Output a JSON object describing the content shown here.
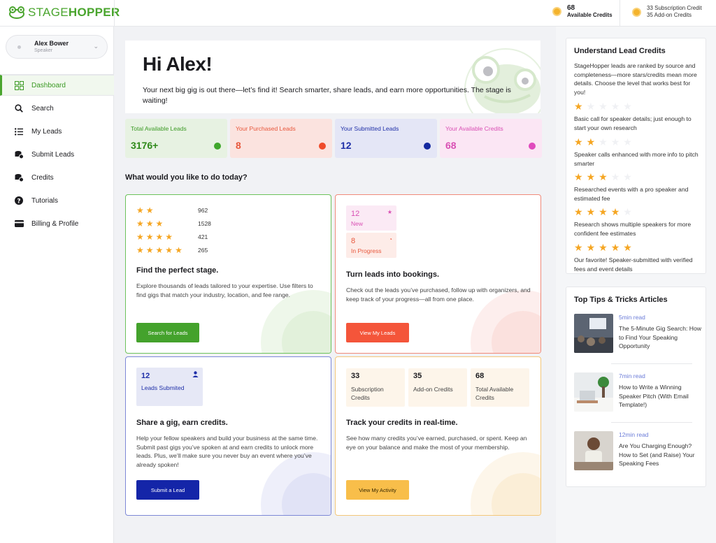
{
  "brand": {
    "part1": "STAGE",
    "part2": "HOPPER"
  },
  "topbar": {
    "available_credits_value": "68",
    "available_credits_label": "Available Credits",
    "subscription_line": "33 Subscription Credit",
    "addon_line": "35 Add-on Credits"
  },
  "user": {
    "name": "Alex Bower",
    "role": "Speaker"
  },
  "nav": [
    {
      "label": "Dashboard",
      "icon": "grid-icon"
    },
    {
      "label": "Search",
      "icon": "search-icon"
    },
    {
      "label": "My Leads",
      "icon": "list-icon"
    },
    {
      "label": "Submit Leads",
      "icon": "coin-stack-icon"
    },
    {
      "label": "Credits",
      "icon": "coin-stack-icon"
    },
    {
      "label": "Tutorials",
      "icon": "question-icon"
    },
    {
      "label": "Billing & Profile",
      "icon": "card-icon"
    }
  ],
  "hero": {
    "greeting": "Hi Alex!",
    "message": "Your next big gig is out there—let’s find it! Search smarter, share leads, and earn more opportunities. The stage is waiting!"
  },
  "stats": [
    {
      "label": "Total Available Leads",
      "value": "3176+",
      "bg": "#e7f2e2",
      "label_color": "#3b9a24",
      "value_color": "#2f8a1a",
      "dot": "#3fa72c"
    },
    {
      "label": "Your Purchased Leads",
      "value": "8",
      "bg": "#fbe3df",
      "label_color": "#e8573c",
      "value_color": "#e8573c",
      "dot": "#ef4b2a"
    },
    {
      "label": "Your Submitted Leads",
      "value": "12",
      "bg": "#e4e6f6",
      "label_color": "#1f2fa8",
      "value_color": "#1f2fa8",
      "dot": "#1429a0"
    },
    {
      "label": "Your Available Credits",
      "value": "68",
      "bg": "#fbe6f4",
      "label_color": "#d94fb4",
      "value_color": "#d94fb4",
      "dot": "#e04bbd"
    }
  ],
  "section_title": "What would you like to do today?",
  "card_find": {
    "ratings": [
      {
        "stars": 2,
        "count": "962"
      },
      {
        "stars": 3,
        "count": "1528"
      },
      {
        "stars": 4,
        "count": "421"
      },
      {
        "stars": 5,
        "count": "265"
      }
    ],
    "title": "Find the perfect stage.",
    "desc": "Explore thousands of leads tailored to your expertise. Use filters to find gigs that match your industry, location, and fee range.",
    "button": "Search for Leads"
  },
  "card_leads": {
    "new_count": "12",
    "new_label": "New",
    "progress_count": "8",
    "progress_label": "In Progress",
    "title": "Turn leads into bookings.",
    "desc": "Check out the leads you’ve purchased, follow up with organizers, and keep track of your progress—all from one place.",
    "button": "View My Leads"
  },
  "card_share": {
    "count": "12",
    "count_label": "Leads Submited",
    "title": "Share a gig, earn credits.",
    "desc": "Help your fellow speakers and build your business at the same time. Submit past gigs you’ve spoken at and earn credits to unlock more leads. Plus, we’ll make sure you never buy an event where you’ve already spoken!",
    "button": "Submit a Lead"
  },
  "card_track": {
    "boxes": [
      {
        "value": "33",
        "label": "Subscription Credits"
      },
      {
        "value": "35",
        "label": "Add-on Credits"
      },
      {
        "value": "68",
        "label": "Total Available Credits"
      }
    ],
    "title": "Track your credits in real-time.",
    "desc": "See how many credits you’ve earned, purchased, or spent. Keep an eye on your balance and make the most of your membership.",
    "button": "View My Activity"
  },
  "lead_credits": {
    "title": "Understand Lead Credits",
    "intro": "StageHopper leads are ranked by source and completeness—more stars/credits mean more details. Choose the level that works best for you!",
    "levels": [
      {
        "stars": 1,
        "text": "Basic call for speaker details; just enough to start your own research"
      },
      {
        "stars": 2,
        "text": "Speaker calls enhanced with more info to pitch smarter"
      },
      {
        "stars": 3,
        "text": "Researched events with a pro speaker and estimated fee"
      },
      {
        "stars": 4,
        "text": "Research shows multiple speakers for more confident fee estimates"
      },
      {
        "stars": 5,
        "text": "Our favorite! Speaker-submitted with verified fees and event details"
      }
    ]
  },
  "tips": {
    "title": "Top Tips & Tricks Articles",
    "articles": [
      {
        "read": "5min read",
        "title": "The 5-Minute Gig Search: How to Find Your Speaking Opportunity"
      },
      {
        "read": "7min read",
        "title": "How to Write a Winning Speaker Pitch (With Email Template!)"
      },
      {
        "read": "12min read",
        "title": "Are You Charging Enough? How to Set (and Raise) Your Speaking Fees"
      }
    ]
  }
}
